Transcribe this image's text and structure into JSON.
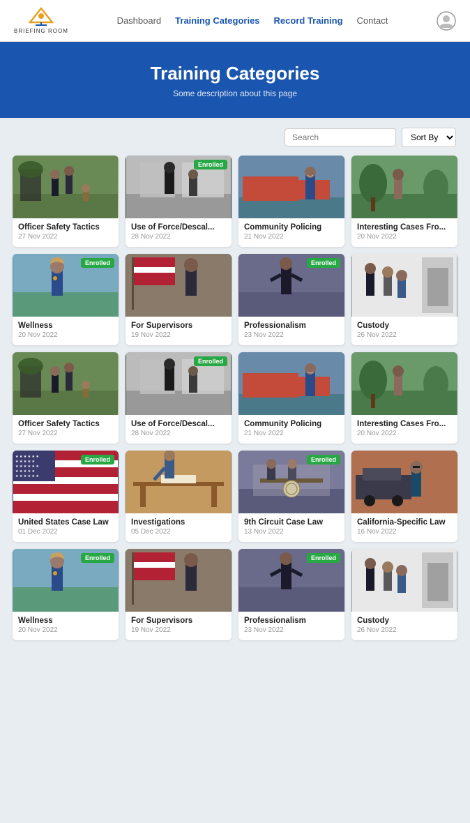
{
  "nav": {
    "logo_text": "BRIEFING ROOM",
    "links": [
      {
        "label": "Dashboard",
        "active": false
      },
      {
        "label": "Training Categories",
        "active": true
      },
      {
        "label": "Record Training",
        "active": false
      },
      {
        "label": "Contact",
        "active": false
      }
    ]
  },
  "hero": {
    "title": "Training Categories",
    "description": "Some description about this page"
  },
  "toolbar": {
    "search_placeholder": "Search",
    "sort_label": "Sort By"
  },
  "cards": [
    {
      "title": "Officer Safety Tactics",
      "date": "27 Nov 2022",
      "enrolled": false,
      "img": "outdoor"
    },
    {
      "title": "Use of Force/Descal...",
      "date": "28 Nov 2022",
      "enrolled": true,
      "img": "dark"
    },
    {
      "title": "Community Policing",
      "date": "21 Nov 2022",
      "enrolled": false,
      "img": "blue"
    },
    {
      "title": "Interesting Cases Fro...",
      "date": "20 Nov 2022",
      "enrolled": false,
      "img": "green"
    },
    {
      "title": "Wellness",
      "date": "20 Nov 2022",
      "enrolled": true,
      "img": "wellness"
    },
    {
      "title": "For Supervisors",
      "date": "19 Nov 2022",
      "enrolled": false,
      "img": "supervisors"
    },
    {
      "title": "Professionalism",
      "date": "23 Nov 2022",
      "enrolled": true,
      "img": "professionalism"
    },
    {
      "title": "Custody",
      "date": "26 Nov 2022",
      "enrolled": false,
      "img": "custody"
    },
    {
      "title": "Officer Safety Tactics",
      "date": "27 Nov 2022",
      "enrolled": false,
      "img": "outdoor"
    },
    {
      "title": "Use of Force/Descal...",
      "date": "28 Nov 2022",
      "enrolled": true,
      "img": "dark"
    },
    {
      "title": "Community Policing",
      "date": "21 Nov 2022",
      "enrolled": false,
      "img": "blue"
    },
    {
      "title": "Interesting Cases Fro...",
      "date": "20 Nov 2022",
      "enrolled": false,
      "img": "green"
    },
    {
      "title": "United States Case Law",
      "date": "01 Dec 2022",
      "enrolled": true,
      "img": "flag"
    },
    {
      "title": "Investigations",
      "date": "05 Dec 2022",
      "enrolled": false,
      "img": "investigation"
    },
    {
      "title": "9th Circuit Case Law",
      "date": "13 Nov 2022",
      "enrolled": true,
      "img": "circuit"
    },
    {
      "title": "California-Specific Law",
      "date": "16 Nov 2022",
      "enrolled": false,
      "img": "california"
    },
    {
      "title": "Wellness",
      "date": "20 Nov 2022",
      "enrolled": true,
      "img": "wellness"
    },
    {
      "title": "For Supervisors",
      "date": "19 Nov 2022",
      "enrolled": false,
      "img": "supervisors"
    },
    {
      "title": "Professionalism",
      "date": "23 Nov 2022",
      "enrolled": true,
      "img": "professionalism"
    },
    {
      "title": "Custody",
      "date": "26 Nov 2022",
      "enrolled": false,
      "img": "custody"
    }
  ],
  "enrolled_badge": "Enrolled"
}
